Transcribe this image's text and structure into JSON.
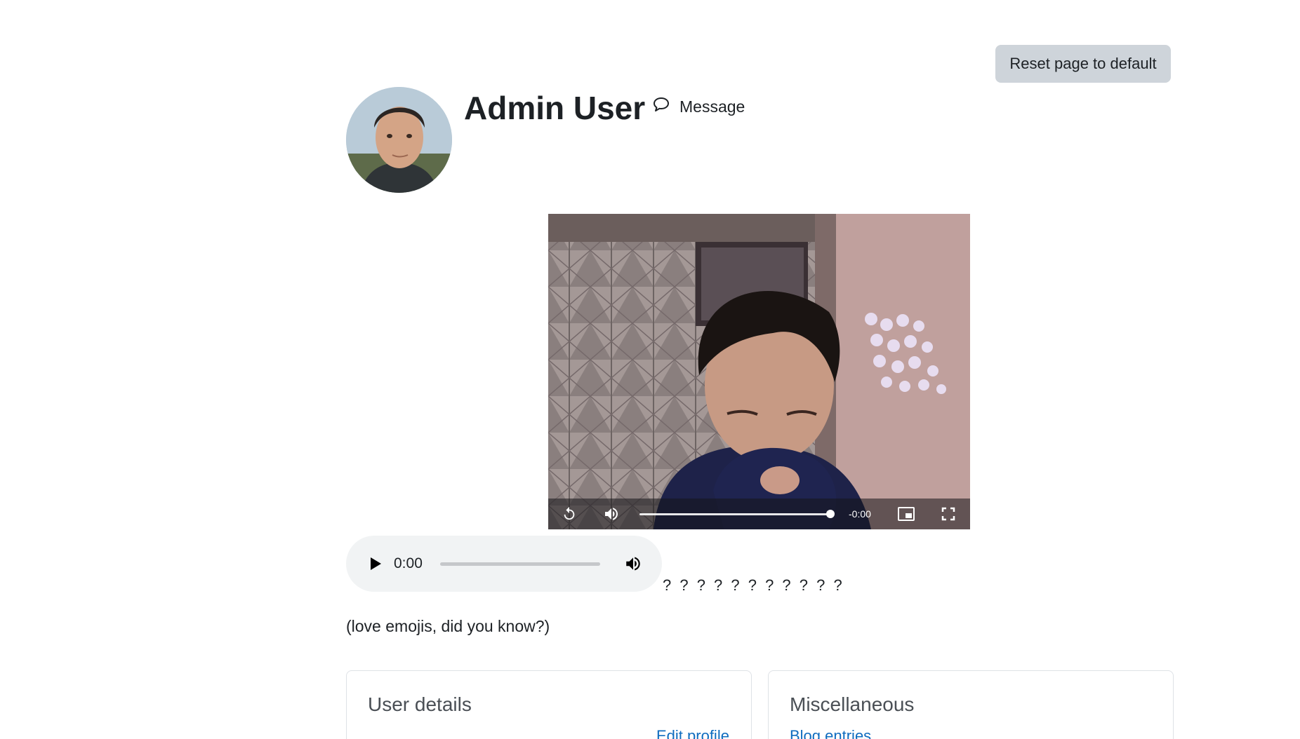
{
  "header": {
    "reset_button": "Reset page to default",
    "user_name": "Admin User",
    "message_link": "Message"
  },
  "video": {
    "remaining_time": "-0:00",
    "progress": 1.0
  },
  "audio": {
    "current_time": "0:00",
    "progress": 0
  },
  "content": {
    "question_marks": "? ? ? ? ? ? ? ? ? ? ?",
    "emoji_note": "(love emojis, did you know?)"
  },
  "cards": {
    "user_details": {
      "title": "User details",
      "link": "Edit profile"
    },
    "miscellaneous": {
      "title": "Miscellaneous",
      "link": "Blog entries"
    }
  },
  "icons": {
    "message": "chat-bubble-icon",
    "replay": "replay-icon",
    "volume": "volume-icon",
    "pip": "picture-in-picture-icon",
    "fullscreen": "fullscreen-icon",
    "play": "play-icon"
  },
  "colors": {
    "button_bg": "#ced4da",
    "link": "#0f6cbf",
    "audio_bg": "#f1f3f4"
  }
}
